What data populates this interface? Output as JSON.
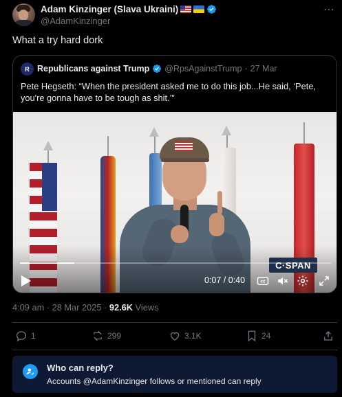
{
  "post": {
    "author": {
      "display_name": "Adam Kinzinger (Slava Ukraini)",
      "handle": "@AdamKinzinger",
      "flags": [
        "us-flag",
        "ukraine-flag"
      ],
      "verified": true
    },
    "text": "What a try hard dork",
    "quote": {
      "author": {
        "display_name": "Republicans against Trump",
        "handle": "@RpsAgainstTrump",
        "separator": "·",
        "date": "27 Mar",
        "verified": true,
        "avatar_text": "R"
      },
      "text": "Pete Hegseth: “When the president asked me to do this job...He said, ‘Pete, you're gonna have to be tough as shit.’”",
      "video": {
        "watermark": "C·SPAN",
        "current_time": "0:07",
        "duration": "0:40",
        "time_display": "0:07 / 0:40",
        "progress_fraction": 0.175
      }
    },
    "timestamp": "4:09 am · 28 Mar 2025 ·",
    "views_count": "92.6K",
    "views_label": "Views",
    "actions": {
      "replies": "1",
      "reposts": "299",
      "likes": "3.1K",
      "bookmarks": "24"
    },
    "reply_settings": {
      "title": "Who can reply?",
      "description": "Accounts @AdamKinzinger follows or mentioned can reply"
    }
  },
  "colors": {
    "background": "#000000",
    "text_primary": "#e7e9ea",
    "text_secondary": "#71767b",
    "accent": "#1d9bf0",
    "border": "#2f3336",
    "reply_banner": "#0e1a33"
  }
}
